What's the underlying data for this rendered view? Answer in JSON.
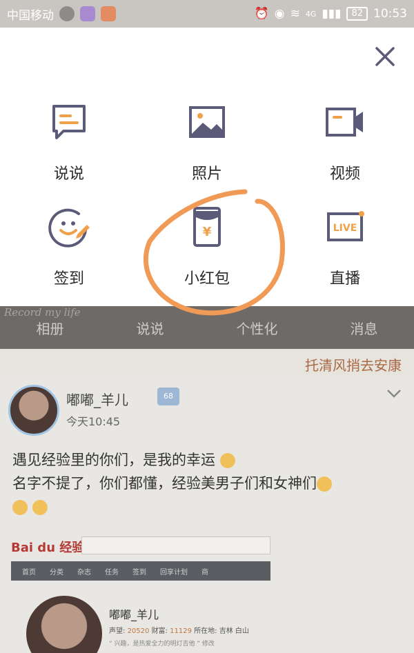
{
  "status": {
    "carrier": "中国移动",
    "network": "4G",
    "battery": "82",
    "time": "10:53"
  },
  "popup": {
    "items": [
      {
        "label": "说说",
        "icon": "comment-icon"
      },
      {
        "label": "照片",
        "icon": "image-icon"
      },
      {
        "label": "视频",
        "icon": "video-camera-icon"
      },
      {
        "label": "签到",
        "icon": "checkin-smiley-icon"
      },
      {
        "label": "小红包",
        "icon": "red-envelope-icon"
      },
      {
        "label": "直播",
        "icon": "live-icon"
      }
    ]
  },
  "background": {
    "record_text": "Record my life",
    "tabs": [
      "相册",
      "说说",
      "个性化",
      "消息"
    ],
    "banner_text": "托清风捎去安康",
    "post": {
      "username": "嘟嘟_羊儿",
      "vip_level": "68",
      "time": "今天10:45",
      "line1": "遇见经验里的你们，是我的幸运",
      "line2": "名字不提了，你们都懂，经验美男子们和女神们"
    },
    "embed": {
      "logo": "Bai du 经验",
      "nav": [
        "首页",
        "分类",
        "杂志",
        "任务",
        "签到",
        "回享计划",
        "商"
      ],
      "name": "嘟嘟_羊儿",
      "stats": {
        "prestige_label": "声望:",
        "prestige": "20520",
        "wealth_label": "财富:",
        "wealth": "11129",
        "location_label": "所在地:",
        "location": "吉林 白山"
      },
      "quote": "“ 兴趣，是热爱全力的明灯吉他 ” 修改"
    }
  },
  "colors": {
    "icon_stroke": "#5b5a78",
    "icon_accent": "#f1a04a",
    "annotation": "#f09a55"
  }
}
